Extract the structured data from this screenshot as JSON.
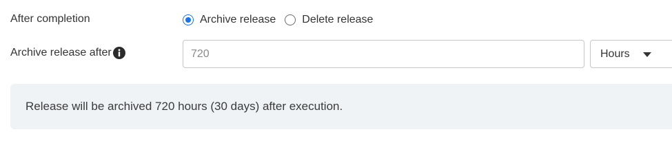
{
  "form": {
    "after_completion_label": "After completion",
    "radio_options": [
      {
        "label": "Archive release",
        "checked": true
      },
      {
        "label": "Delete release",
        "checked": false
      }
    ],
    "archive_after_label": "Archive release after",
    "archive_after_value": "720",
    "unit_select": {
      "selected": "Hours"
    },
    "info_message": "Release will be archived 720 hours (30 days) after execution."
  },
  "colors": {
    "accent": "#1a73e8",
    "banner_bg": "#eff3f5",
    "info_icon": "#2b2b2b"
  }
}
